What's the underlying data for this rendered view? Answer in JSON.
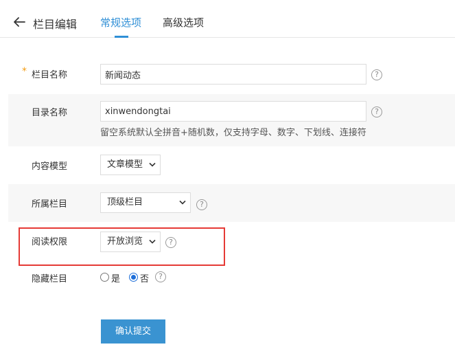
{
  "header": {
    "title": "栏目编辑",
    "tabs": [
      {
        "label": "常规选项",
        "active": true
      },
      {
        "label": "高级选项",
        "active": false
      }
    ]
  },
  "form": {
    "column_name": {
      "label": "栏目名称",
      "required_mark": "*",
      "value": "新闻动态"
    },
    "directory_name": {
      "label": "目录名称",
      "value": "xinwendongtai",
      "hint": "留空系统默认全拼音+随机数，仅支持字母、数字、下划线、连接符"
    },
    "content_model": {
      "label": "内容模型",
      "selected": "文章模型"
    },
    "parent_column": {
      "label": "所属栏目",
      "selected": "顶级栏目"
    },
    "read_permission": {
      "label": "阅读权限",
      "selected": "开放浏览"
    },
    "hidden_column": {
      "label": "隐藏栏目",
      "options": [
        {
          "label": "是",
          "checked": false
        },
        {
          "label": "否",
          "checked": true
        }
      ]
    },
    "help_symbol": "?"
  },
  "submit_label": "确认提交",
  "colors": {
    "accent": "#2f8fd6",
    "button": "#3a93d1",
    "required": "#f39c12",
    "highlight": "#e53935"
  }
}
